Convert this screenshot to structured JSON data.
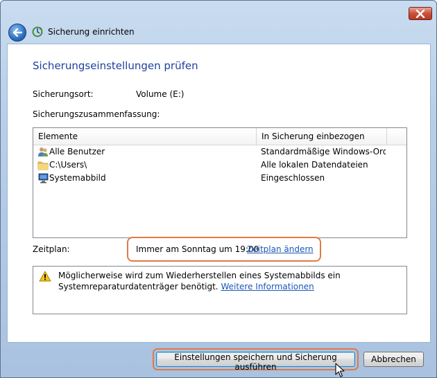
{
  "window": {
    "title": "Sicherung einrichten",
    "icons": {
      "back": "back-arrow-icon",
      "app": "backup-icon",
      "close": "close-icon"
    }
  },
  "main": {
    "heading": "Sicherungseinstellungen prüfen",
    "location_label": "Sicherungsort:",
    "location_value": "Volume (E:)",
    "summary_label": "Sicherungszusammenfassung:"
  },
  "table": {
    "columns": [
      "Elemente",
      "In Sicherung einbezogen"
    ],
    "rows": [
      {
        "icon": "users-icon",
        "item": "Alle Benutzer",
        "included": "Standardmäßige Windows-Ord..."
      },
      {
        "icon": "folder-icon",
        "item": "C:\\Users\\",
        "included": "Alle lokalen Datendateien"
      },
      {
        "icon": "computer-icon",
        "item": "Systemabbild",
        "included": "Eingeschlossen"
      }
    ]
  },
  "schedule": {
    "label": "Zeitplan:",
    "value": "Immer am Sonntag um 19:00",
    "change_link": "Zeitplan ändern"
  },
  "warning": {
    "icon": "warning-icon",
    "line1": "Möglicherweise wird zum Wiederherstellen eines Systemabbilds ein",
    "line2": "Systemreparaturdatenträger benötigt.",
    "link": "Weitere Informationen"
  },
  "footer": {
    "save_button": "Einstellungen speichern und Sicherung ausführen",
    "cancel_button": "Abbrechen"
  },
  "colors": {
    "highlight": "#e07a45",
    "link": "#1a57b8",
    "heading": "#1e3f9f"
  }
}
